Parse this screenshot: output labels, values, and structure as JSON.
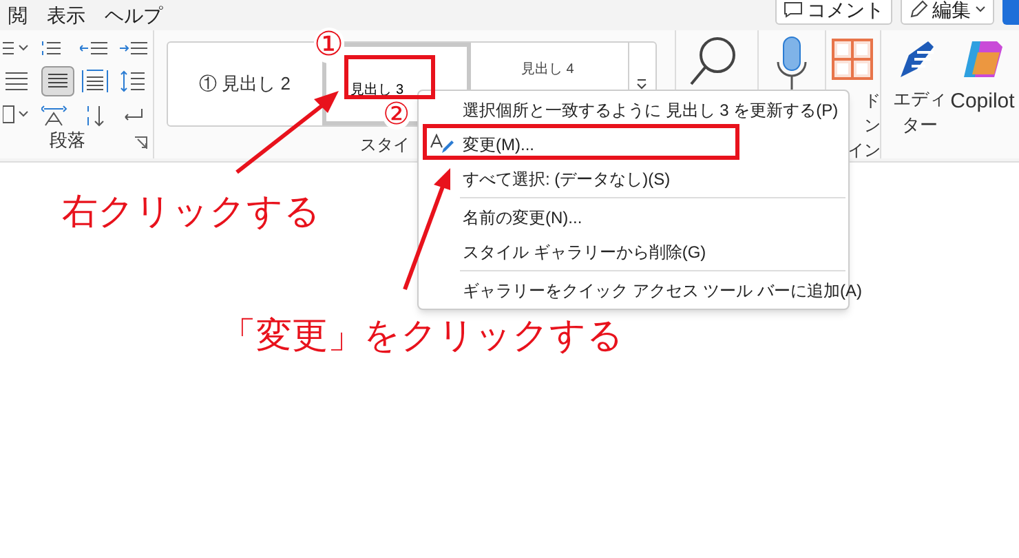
{
  "menu_bar": {
    "tabs": [
      {
        "label": "閲"
      },
      {
        "label": "表示"
      },
      {
        "label": "ヘルプ"
      }
    ]
  },
  "top_buttons": [
    {
      "label": "コメント",
      "kind": "comment"
    },
    {
      "label": "編集",
      "kind": "edit"
    }
  ],
  "ribbon": {
    "paragraph_group_label": "段落",
    "styles": [
      {
        "label": "① 見出し 2",
        "selected": false
      },
      {
        "label": "見出し 3",
        "selected": true
      },
      {
        "label": "見出し 4",
        "selected": false
      }
    ],
    "styles_group_label": "スタイ",
    "addin_label_lines": [
      "ド",
      "ン",
      "イン"
    ],
    "editor_label_lines": [
      "エディ",
      "ター"
    ],
    "copilot_label": "Copilot"
  },
  "context_menu": {
    "items": [
      {
        "label": "選択個所と一致するように 見出し 3 を更新する(P)",
        "divider_before": false,
        "kind": "plain"
      },
      {
        "label": "変更(M)...",
        "divider_before": false,
        "kind": "modify"
      },
      {
        "label": "すべて選択: (データなし)(S)",
        "divider_before": false,
        "kind": "plain"
      },
      {
        "label": "名前の変更(N)...",
        "divider_before": true,
        "kind": "plain"
      },
      {
        "label": "スタイル ギャラリーから削除(G)",
        "divider_before": false,
        "kind": "plain"
      },
      {
        "label": "ギャラリーをクイック アクセス ツール バーに追加(A)",
        "divider_before": true,
        "kind": "plain"
      }
    ]
  },
  "annotations": {
    "markers": [
      "①",
      "②"
    ],
    "callouts": [
      "右クリックする",
      "「変更」をクリックする"
    ]
  }
}
